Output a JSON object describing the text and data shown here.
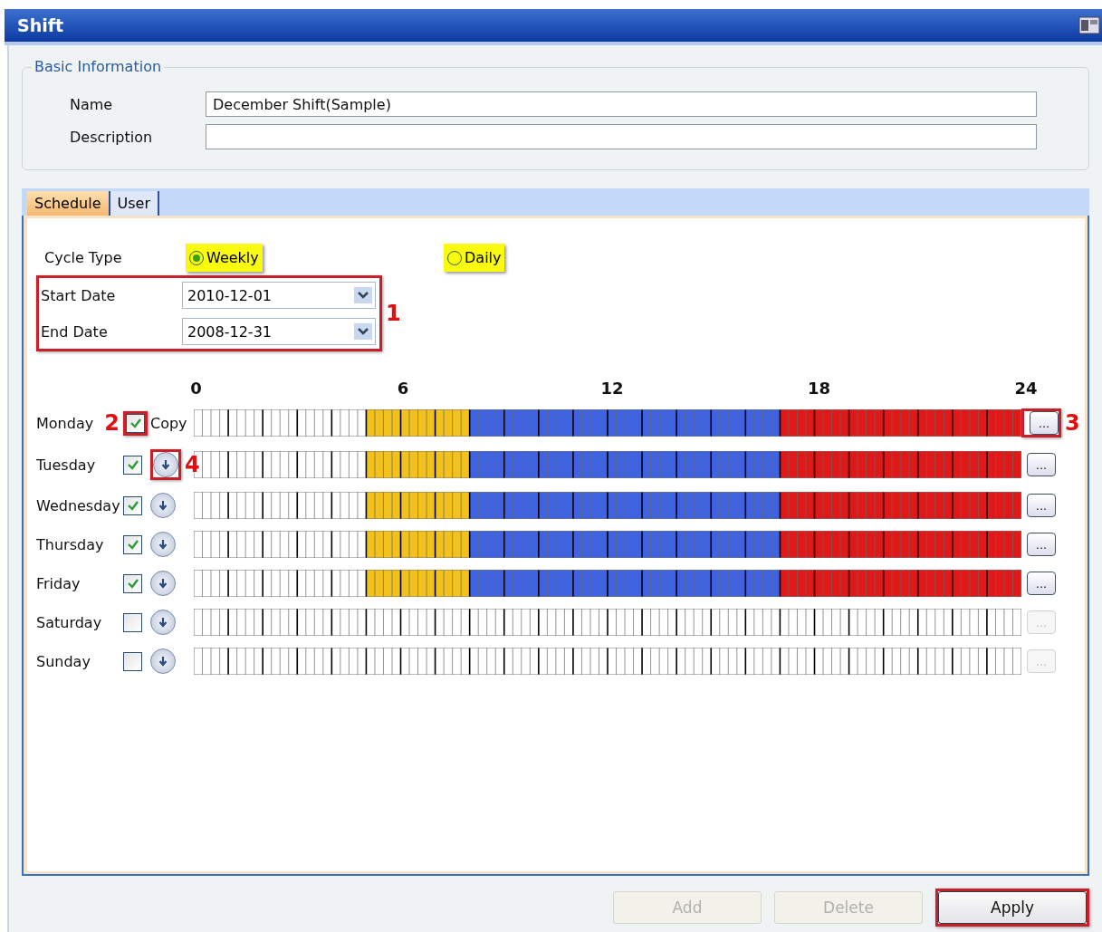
{
  "window": {
    "title": "Shift"
  },
  "basic_information": {
    "legend": "Basic Information",
    "fields": [
      {
        "label": "Name",
        "value": "December Shift(Sample)"
      },
      {
        "label": "Description"
      }
    ]
  },
  "tabs": [
    {
      "label": "Schedule",
      "selected": true
    },
    {
      "label": "User",
      "selected": false
    }
  ],
  "cycle_type": {
    "label": "Cycle Type",
    "options": [
      {
        "kind": "highlighted",
        "label": "Weekly",
        "selected": true
      },
      {
        "kind": "highlighted",
        "label": "Daily",
        "selected": false
      }
    ]
  },
  "dates": {
    "callout": "1",
    "fields": [
      {
        "label": "Start Date",
        "value": "2010-12-01"
      },
      {
        "label": "End Date",
        "value": "2008-12-31"
      }
    ]
  },
  "hour_ticks": [
    "0",
    "6",
    "12",
    "18",
    "24"
  ],
  "days": [
    {
      "name": "Monday",
      "checked": true,
      "check_callout": "2",
      "copy": "Copy",
      "edit_callout": "3",
      "hours": [
        {
          "filled": false
        },
        {
          "filled": false
        },
        {
          "filled": false
        },
        {
          "filled": false
        },
        {
          "filled": false
        },
        {
          "filled": true,
          "color": "#f2c11c"
        },
        {
          "filled": true,
          "color": "#f2c11c"
        },
        {
          "filled": true,
          "color": "#f2c11c"
        },
        {
          "filled": true,
          "color": "#3f62e0"
        },
        {
          "filled": true,
          "color": "#3f62e0"
        },
        {
          "filled": true,
          "color": "#3f62e0"
        },
        {
          "filled": true,
          "color": "#3f62e0"
        },
        {
          "filled": true,
          "color": "#3f62e0"
        },
        {
          "filled": true,
          "color": "#3f62e0"
        },
        {
          "filled": true,
          "color": "#3f62e0"
        },
        {
          "filled": true,
          "color": "#3f62e0"
        },
        {
          "filled": true,
          "color": "#3f62e0"
        },
        {
          "filled": true,
          "color": "#e01818"
        },
        {
          "filled": true,
          "color": "#e01818"
        },
        {
          "filled": true,
          "color": "#e01818"
        },
        {
          "filled": true,
          "color": "#e01818"
        },
        {
          "filled": true,
          "color": "#e01818"
        },
        {
          "filled": true,
          "color": "#e01818"
        },
        {
          "filled": true,
          "color": "#e01818"
        }
      ]
    },
    {
      "name": "Tuesday",
      "checked": true,
      "copy_callout": "4",
      "hours": [
        {
          "filled": false
        },
        {
          "filled": false
        },
        {
          "filled": false
        },
        {
          "filled": false
        },
        {
          "filled": false
        },
        {
          "filled": true,
          "color": "#f2c11c"
        },
        {
          "filled": true,
          "color": "#f2c11c"
        },
        {
          "filled": true,
          "color": "#f2c11c"
        },
        {
          "filled": true,
          "color": "#3f62e0"
        },
        {
          "filled": true,
          "color": "#3f62e0"
        },
        {
          "filled": true,
          "color": "#3f62e0"
        },
        {
          "filled": true,
          "color": "#3f62e0"
        },
        {
          "filled": true,
          "color": "#3f62e0"
        },
        {
          "filled": true,
          "color": "#3f62e0"
        },
        {
          "filled": true,
          "color": "#3f62e0"
        },
        {
          "filled": true,
          "color": "#3f62e0"
        },
        {
          "filled": true,
          "color": "#3f62e0"
        },
        {
          "filled": true,
          "color": "#e01818"
        },
        {
          "filled": true,
          "color": "#e01818"
        },
        {
          "filled": true,
          "color": "#e01818"
        },
        {
          "filled": true,
          "color": "#e01818"
        },
        {
          "filled": true,
          "color": "#e01818"
        },
        {
          "filled": true,
          "color": "#e01818"
        },
        {
          "filled": true,
          "color": "#e01818"
        }
      ]
    },
    {
      "name": "Wednesday",
      "checked": true,
      "hours": [
        {
          "filled": false
        },
        {
          "filled": false
        },
        {
          "filled": false
        },
        {
          "filled": false
        },
        {
          "filled": false
        },
        {
          "filled": true,
          "color": "#f2c11c"
        },
        {
          "filled": true,
          "color": "#f2c11c"
        },
        {
          "filled": true,
          "color": "#f2c11c"
        },
        {
          "filled": true,
          "color": "#3f62e0"
        },
        {
          "filled": true,
          "color": "#3f62e0"
        },
        {
          "filled": true,
          "color": "#3f62e0"
        },
        {
          "filled": true,
          "color": "#3f62e0"
        },
        {
          "filled": true,
          "color": "#3f62e0"
        },
        {
          "filled": true,
          "color": "#3f62e0"
        },
        {
          "filled": true,
          "color": "#3f62e0"
        },
        {
          "filled": true,
          "color": "#3f62e0"
        },
        {
          "filled": true,
          "color": "#3f62e0"
        },
        {
          "filled": true,
          "color": "#e01818"
        },
        {
          "filled": true,
          "color": "#e01818"
        },
        {
          "filled": true,
          "color": "#e01818"
        },
        {
          "filled": true,
          "color": "#e01818"
        },
        {
          "filled": true,
          "color": "#e01818"
        },
        {
          "filled": true,
          "color": "#e01818"
        },
        {
          "filled": true,
          "color": "#e01818"
        }
      ]
    },
    {
      "name": "Thursday",
      "checked": true,
      "hours": [
        {
          "filled": false
        },
        {
          "filled": false
        },
        {
          "filled": false
        },
        {
          "filled": false
        },
        {
          "filled": false
        },
        {
          "filled": true,
          "color": "#f2c11c"
        },
        {
          "filled": true,
          "color": "#f2c11c"
        },
        {
          "filled": true,
          "color": "#f2c11c"
        },
        {
          "filled": true,
          "color": "#3f62e0"
        },
        {
          "filled": true,
          "color": "#3f62e0"
        },
        {
          "filled": true,
          "color": "#3f62e0"
        },
        {
          "filled": true,
          "color": "#3f62e0"
        },
        {
          "filled": true,
          "color": "#3f62e0"
        },
        {
          "filled": true,
          "color": "#3f62e0"
        },
        {
          "filled": true,
          "color": "#3f62e0"
        },
        {
          "filled": true,
          "color": "#3f62e0"
        },
        {
          "filled": true,
          "color": "#3f62e0"
        },
        {
          "filled": true,
          "color": "#e01818"
        },
        {
          "filled": true,
          "color": "#e01818"
        },
        {
          "filled": true,
          "color": "#e01818"
        },
        {
          "filled": true,
          "color": "#e01818"
        },
        {
          "filled": true,
          "color": "#e01818"
        },
        {
          "filled": true,
          "color": "#e01818"
        },
        {
          "filled": true,
          "color": "#e01818"
        }
      ]
    },
    {
      "name": "Friday",
      "checked": true,
      "hours": [
        {
          "filled": false
        },
        {
          "filled": false
        },
        {
          "filled": false
        },
        {
          "filled": false
        },
        {
          "filled": false
        },
        {
          "filled": true,
          "color": "#f2c11c"
        },
        {
          "filled": true,
          "color": "#f2c11c"
        },
        {
          "filled": true,
          "color": "#f2c11c"
        },
        {
          "filled": true,
          "color": "#3f62e0"
        },
        {
          "filled": true,
          "color": "#3f62e0"
        },
        {
          "filled": true,
          "color": "#3f62e0"
        },
        {
          "filled": true,
          "color": "#3f62e0"
        },
        {
          "filled": true,
          "color": "#3f62e0"
        },
        {
          "filled": true,
          "color": "#3f62e0"
        },
        {
          "filled": true,
          "color": "#3f62e0"
        },
        {
          "filled": true,
          "color": "#3f62e0"
        },
        {
          "filled": true,
          "color": "#3f62e0"
        },
        {
          "filled": true,
          "color": "#e01818"
        },
        {
          "filled": true,
          "color": "#e01818"
        },
        {
          "filled": true,
          "color": "#e01818"
        },
        {
          "filled": true,
          "color": "#e01818"
        },
        {
          "filled": true,
          "color": "#e01818"
        },
        {
          "filled": true,
          "color": "#e01818"
        },
        {
          "filled": true,
          "color": "#e01818"
        }
      ]
    },
    {
      "name": "Saturday",
      "checked": false,
      "hours": [
        {
          "filled": false
        },
        {
          "filled": false
        },
        {
          "filled": false
        },
        {
          "filled": false
        },
        {
          "filled": false
        },
        {
          "filled": false
        },
        {
          "filled": false
        },
        {
          "filled": false
        },
        {
          "filled": false
        },
        {
          "filled": false
        },
        {
          "filled": false
        },
        {
          "filled": false
        },
        {
          "filled": false
        },
        {
          "filled": false
        },
        {
          "filled": false
        },
        {
          "filled": false
        },
        {
          "filled": false
        },
        {
          "filled": false
        },
        {
          "filled": false
        },
        {
          "filled": false
        },
        {
          "filled": false
        },
        {
          "filled": false
        },
        {
          "filled": false
        },
        {
          "filled": false
        }
      ]
    },
    {
      "name": "Sunday",
      "checked": false,
      "hours": [
        {
          "filled": false
        },
        {
          "filled": false
        },
        {
          "filled": false
        },
        {
          "filled": false
        },
        {
          "filled": false
        },
        {
          "filled": false
        },
        {
          "filled": false
        },
        {
          "filled": false
        },
        {
          "filled": false
        },
        {
          "filled": false
        },
        {
          "filled": false
        },
        {
          "filled": false
        },
        {
          "filled": false
        },
        {
          "filled": false
        },
        {
          "filled": false
        },
        {
          "filled": false
        },
        {
          "filled": false
        },
        {
          "filled": false
        },
        {
          "filled": false
        },
        {
          "filled": false
        },
        {
          "filled": false
        },
        {
          "filled": false
        },
        {
          "filled": false
        },
        {
          "filled": false
        }
      ]
    }
  ],
  "edit_button": {
    "label": "..."
  },
  "buttons": [
    {
      "label": "Add",
      "disabled": true,
      "outlined": false
    },
    {
      "label": "Delete",
      "disabled": true,
      "outlined": false
    },
    {
      "label": "Apply",
      "disabled": false,
      "outlined": true
    }
  ]
}
